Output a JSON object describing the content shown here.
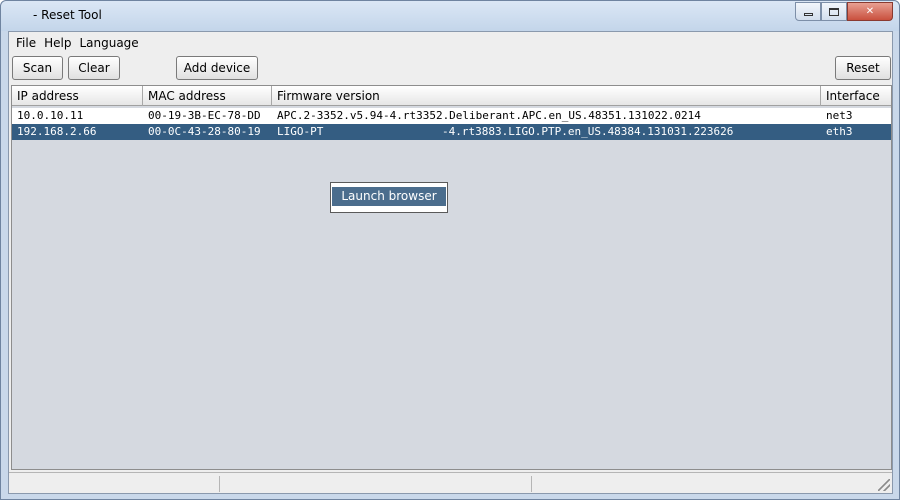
{
  "window": {
    "title": "- Reset Tool",
    "controls": {
      "minimize": "minimize",
      "maximize": "maximize",
      "close": "✕"
    }
  },
  "menu": {
    "items": [
      "File",
      "Help",
      "Language"
    ]
  },
  "toolbar": {
    "scan_label": "Scan",
    "clear_label": "Clear",
    "add_device_label": "Add device",
    "reset_label": "Reset"
  },
  "table": {
    "columns": [
      "IP address",
      "MAC address",
      "Firmware version",
      "Interface"
    ],
    "rows": [
      {
        "ip": "10.0.10.11",
        "mac": "00-19-3B-EC-78-DD",
        "firmware": "APC.2-3352.v5.94-4.rt3352.Deliberant.APC.en_US.48351.131022.0214",
        "interface": "net3",
        "selected": false
      },
      {
        "ip": "192.168.2.66",
        "mac": "00-0C-43-28-80-19",
        "firmware_visible_prefix": "LIGO-PT",
        "firmware_visible_suffix": "-4.rt3883.LIGO.PTP.en_US.48384.131031.223626",
        "interface": "eth3",
        "selected": true
      }
    ]
  },
  "context_menu": {
    "items": [
      "Launch browser"
    ]
  },
  "colors": {
    "selection": "#345d82",
    "context_highlight": "#4b6d8d",
    "table_background": "#d5d9e0",
    "titlebar": "#c9d8ea"
  }
}
